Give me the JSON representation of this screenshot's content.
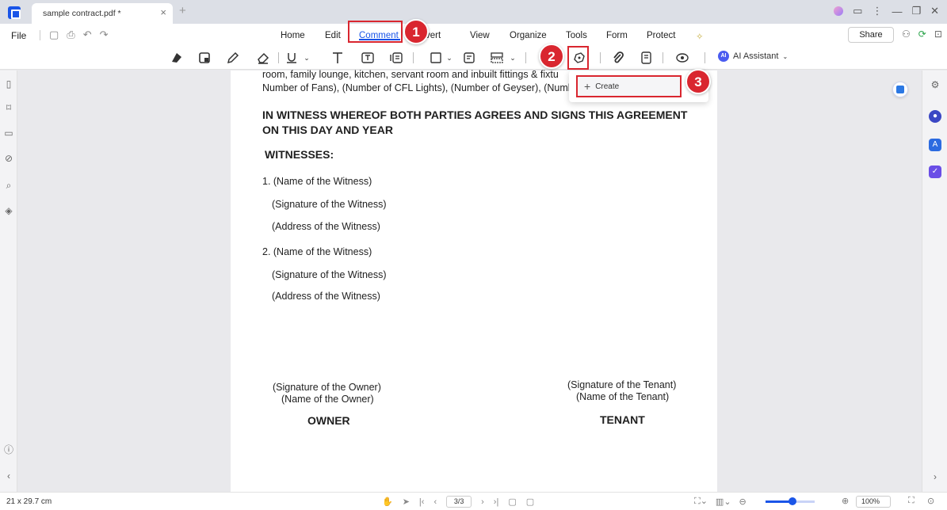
{
  "titlebar": {
    "tab_title": "sample contract.pdf *",
    "close_glyph": "×",
    "new_tab_glyph": "+"
  },
  "menubar": {
    "file": "File",
    "items": [
      "Home",
      "Edit",
      "Comment",
      "Convert",
      "View",
      "Organize",
      "Tools",
      "Form",
      "Protect"
    ],
    "active": "Comment",
    "share": "Share"
  },
  "toolbar": {
    "ai_assistant": "AI Assistant",
    "ai_badge": "AI"
  },
  "dropdown": {
    "create": "Create",
    "plus": "+"
  },
  "annotations": {
    "step1": "1",
    "step2": "2",
    "step3": "3",
    "color": "#d9262f"
  },
  "document": {
    "line1": "room, family lounge, kitchen, servant room and inbuilt fittings & fixtu",
    "line2": "Number of Fans), (Number of CFL Lights), (Number of Geyser), (Numb",
    "witness_heading_1": "IN WITNESS WHEREOF BOTH PARTIES AGREES AND SIGNS THIS AGREEMENT",
    "witness_heading_2": "ON THIS DAY AND YEAR",
    "witnesses": "WITNESSES:",
    "w1_name": "1. (Name of the Witness)",
    "w1_sig": "(Signature of the Witness)",
    "w1_addr": "(Address of the Witness)",
    "w2_name": "2. (Name of the Witness)",
    "w2_sig": "(Signature of the Witness)",
    "w2_addr": "(Address of the Witness)",
    "owner_sig": "(Signature of the Owner)",
    "owner_name": "(Name of the Owner)",
    "owner": "OWNER",
    "tenant_sig": "(Signature of the Tenant)",
    "tenant_name": "(Name of the Tenant)",
    "tenant": "TENANT"
  },
  "statusbar": {
    "page_size": "21 x 29.7 cm",
    "page_field": "3/3",
    "zoom": "100%",
    "zoom_fraction": 0.55
  },
  "colors": {
    "accent": "#1a55e8"
  }
}
